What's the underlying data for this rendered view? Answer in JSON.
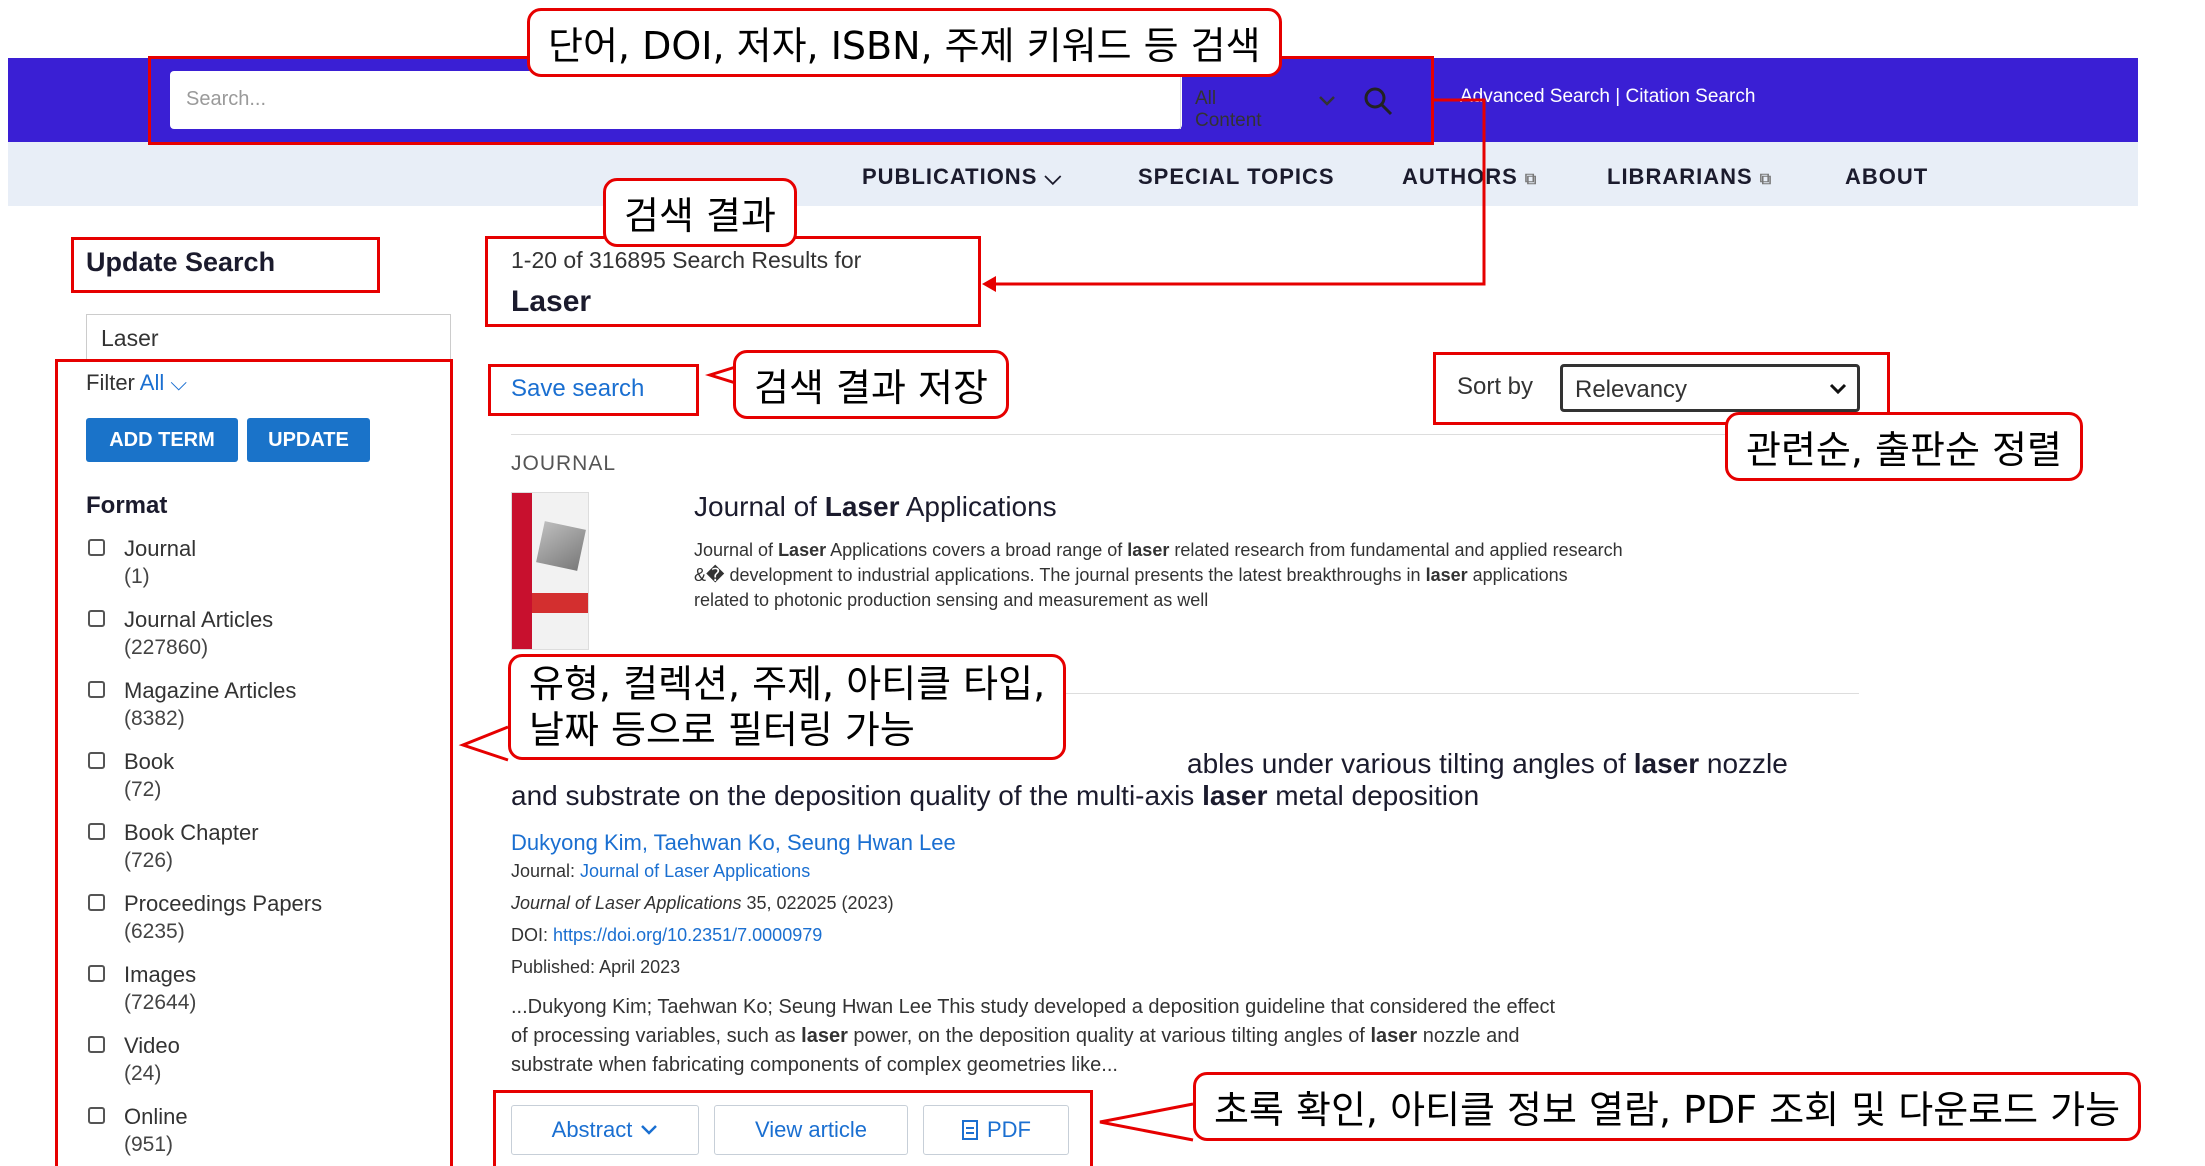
{
  "header": {
    "search_placeholder": "Search...",
    "scope_label": "All Content",
    "advanced_links": "Advanced Search | Citation Search"
  },
  "nav": {
    "items": [
      "PUBLICATIONS",
      "SPECIAL TOPICS",
      "AUTHORS",
      "LIBRARIANS",
      "ABOUT"
    ]
  },
  "sidebar": {
    "title": "Update Search",
    "term_value": "Laser",
    "filter_label": "Filter",
    "filter_value": "All",
    "add_term": "ADD TERM",
    "update": "UPDATE",
    "format_heading": "Format",
    "formats": [
      {
        "label": "Journal",
        "count": "(1)"
      },
      {
        "label": "Journal Articles",
        "count": "(227860)"
      },
      {
        "label": "Magazine Articles",
        "count": "(8382)"
      },
      {
        "label": "Book",
        "count": "(72)"
      },
      {
        "label": "Book Chapter",
        "count": "(726)"
      },
      {
        "label": "Proceedings Papers",
        "count": "(6235)"
      },
      {
        "label": "Images",
        "count": "(72644)"
      },
      {
        "label": "Video",
        "count": "(24)"
      },
      {
        "label": "Online",
        "count": "(951)"
      }
    ]
  },
  "results": {
    "summary": "1-20 of 316895 Search Results for",
    "query": "Laser",
    "save_search": "Save search",
    "sort_label": "Sort by",
    "sort_value": "Relevancy",
    "journal_section": "JOURNAL",
    "journal": {
      "title_pre": "Journal of ",
      "title_bold": "Laser",
      "title_post": " Applications",
      "d1a": "Journal of ",
      "d1b": "Laser",
      "d1c": " Applications covers a broad range of ",
      "d1d": "laser",
      "d1e": " related research from fundamental and applied research",
      "d2a": "&� development to industrial applications. The journal presents the latest breakthroughs in ",
      "d2b": "laser",
      "d2c": " applications",
      "d3": "related to photonic production sensing and measurement as well"
    },
    "article": {
      "t1a": "ables under various tilting angles of ",
      "t1b": "laser",
      "t1c": " nozzle",
      "t2a": "and substrate on the deposition quality of the multi-axis ",
      "t2b": "laser",
      "t2c": " metal deposition",
      "authors": "Dukyong Kim, Taehwan Ko, Seung Hwan Lee",
      "journal_label": "Journal: ",
      "journal_name": "Journal of Laser Applications",
      "citation_italic": "Journal of Laser Applications",
      "citation_rest": " 35, 022025 (2023)",
      "doi_label": "DOI: ",
      "doi": "https://doi.org/10.2351/7.0000979",
      "published": "Published: April 2023",
      "s1": "...Dukyong Kim; Taehwan Ko; Seung Hwan Lee This study developed a deposition guideline that considered the effect",
      "s2a": "of processing variables, such as ",
      "s2b": "laser",
      "s2c": " power, on the deposition quality at various tilting angles of ",
      "s2d": "laser",
      "s2e": " nozzle and",
      "s3": "substrate when fabricating components of complex geometries like...",
      "abstract_btn": "Abstract",
      "view_btn": "View article",
      "pdf_btn": "PDF"
    }
  },
  "annotations": {
    "search": "단어, DOI, 저자, ISBN, 주제 키워드 등 검색",
    "results": "검색 결과",
    "save": "검색 결과 저장",
    "sort": "관련순, 출판순 정렬",
    "filter_line1": "유형, 컬렉션, 주제, 아티클 타입,",
    "filter_line2": "날짜 등으로 필터링 가능",
    "actions": "초록 확인, 아티클 정보 열람, PDF 조회 및 다운로드 가능"
  },
  "colors": {
    "topbar": "#3a1fd4",
    "navbar": "#e8eef7",
    "accent": "#1a73c9",
    "annotation": "#e60000"
  }
}
